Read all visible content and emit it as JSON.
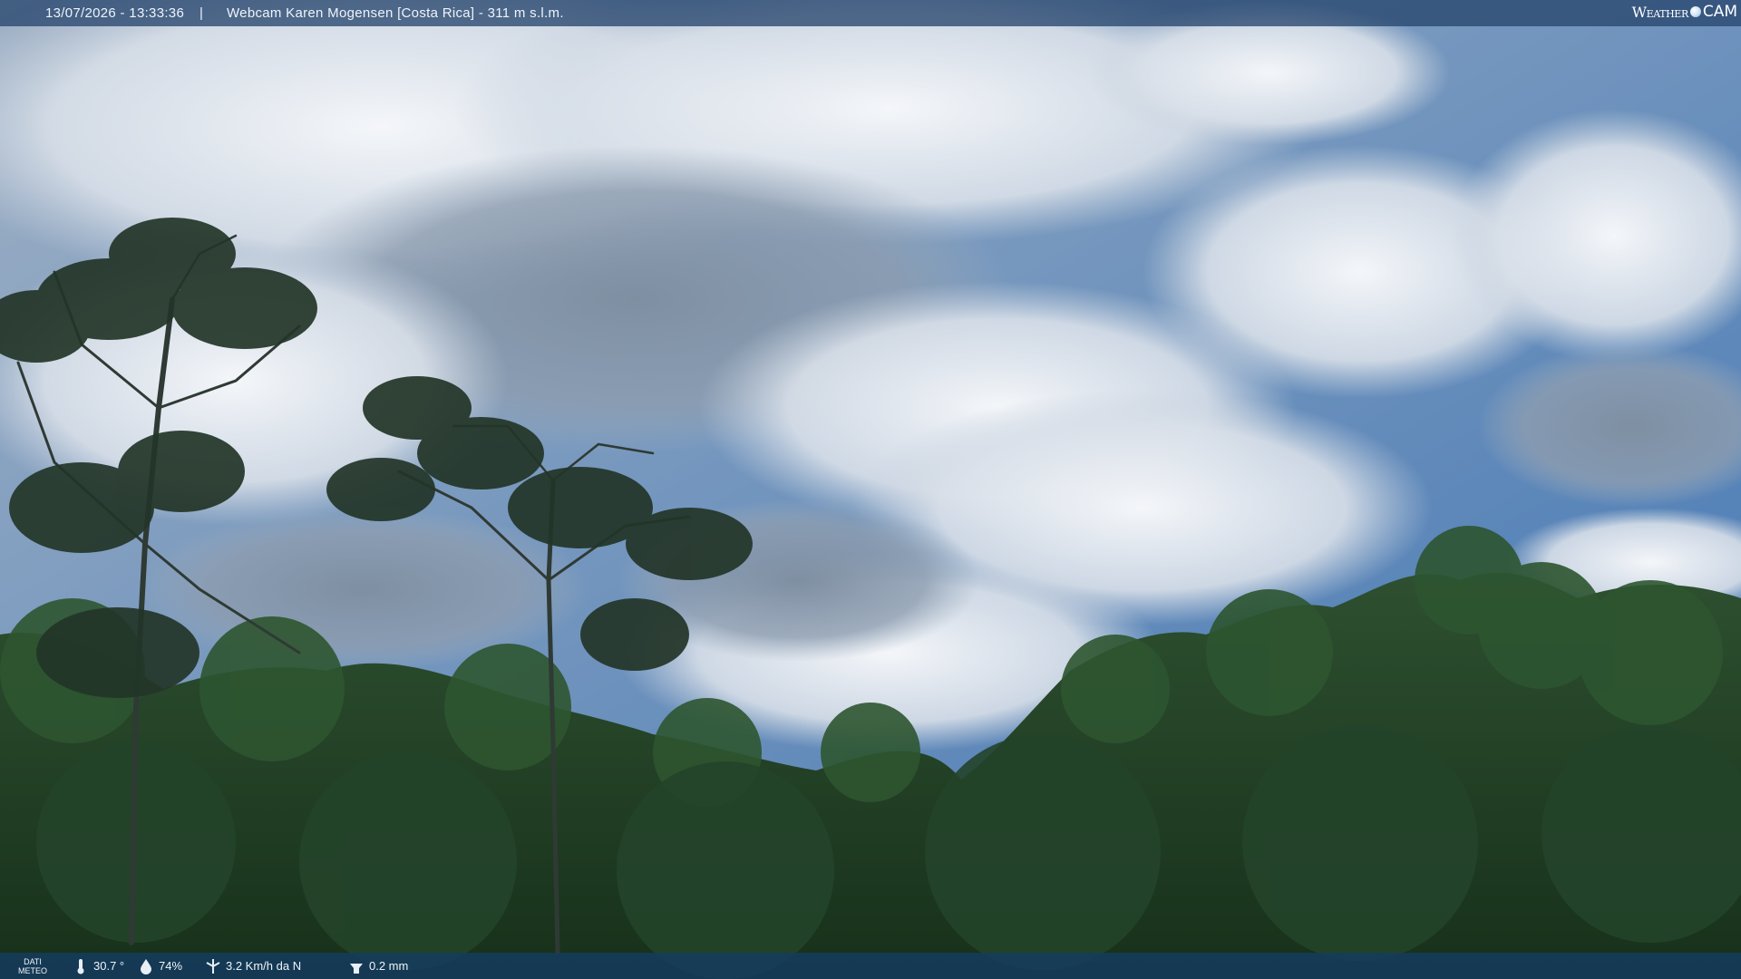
{
  "header": {
    "datetime": "13/07/2026 - 13:33:36",
    "separator": "|",
    "title": "Webcam Karen Mogensen [Costa Rica] - 311 m s.l.m.",
    "logo": {
      "weather": "Weather",
      "cam": "CAM"
    }
  },
  "footer": {
    "label_line1": "DATI",
    "label_line2": "METEO",
    "temperature": "30.7 °",
    "humidity": "74%",
    "wind": "3.2 Km/h da N",
    "rain": "0.2 mm"
  },
  "colors": {
    "sky_blue": "#4f7fb5",
    "cloud_white": "#eef2f7",
    "cloud_gray": "#8b9cb0",
    "forest_dark": "#1f3a22",
    "forest_mid": "#2f5530",
    "bar_bg": "#28466e"
  },
  "icons": [
    "thermometer-icon",
    "humidity-drop-icon",
    "wind-icon",
    "rain-gauge-icon"
  ]
}
